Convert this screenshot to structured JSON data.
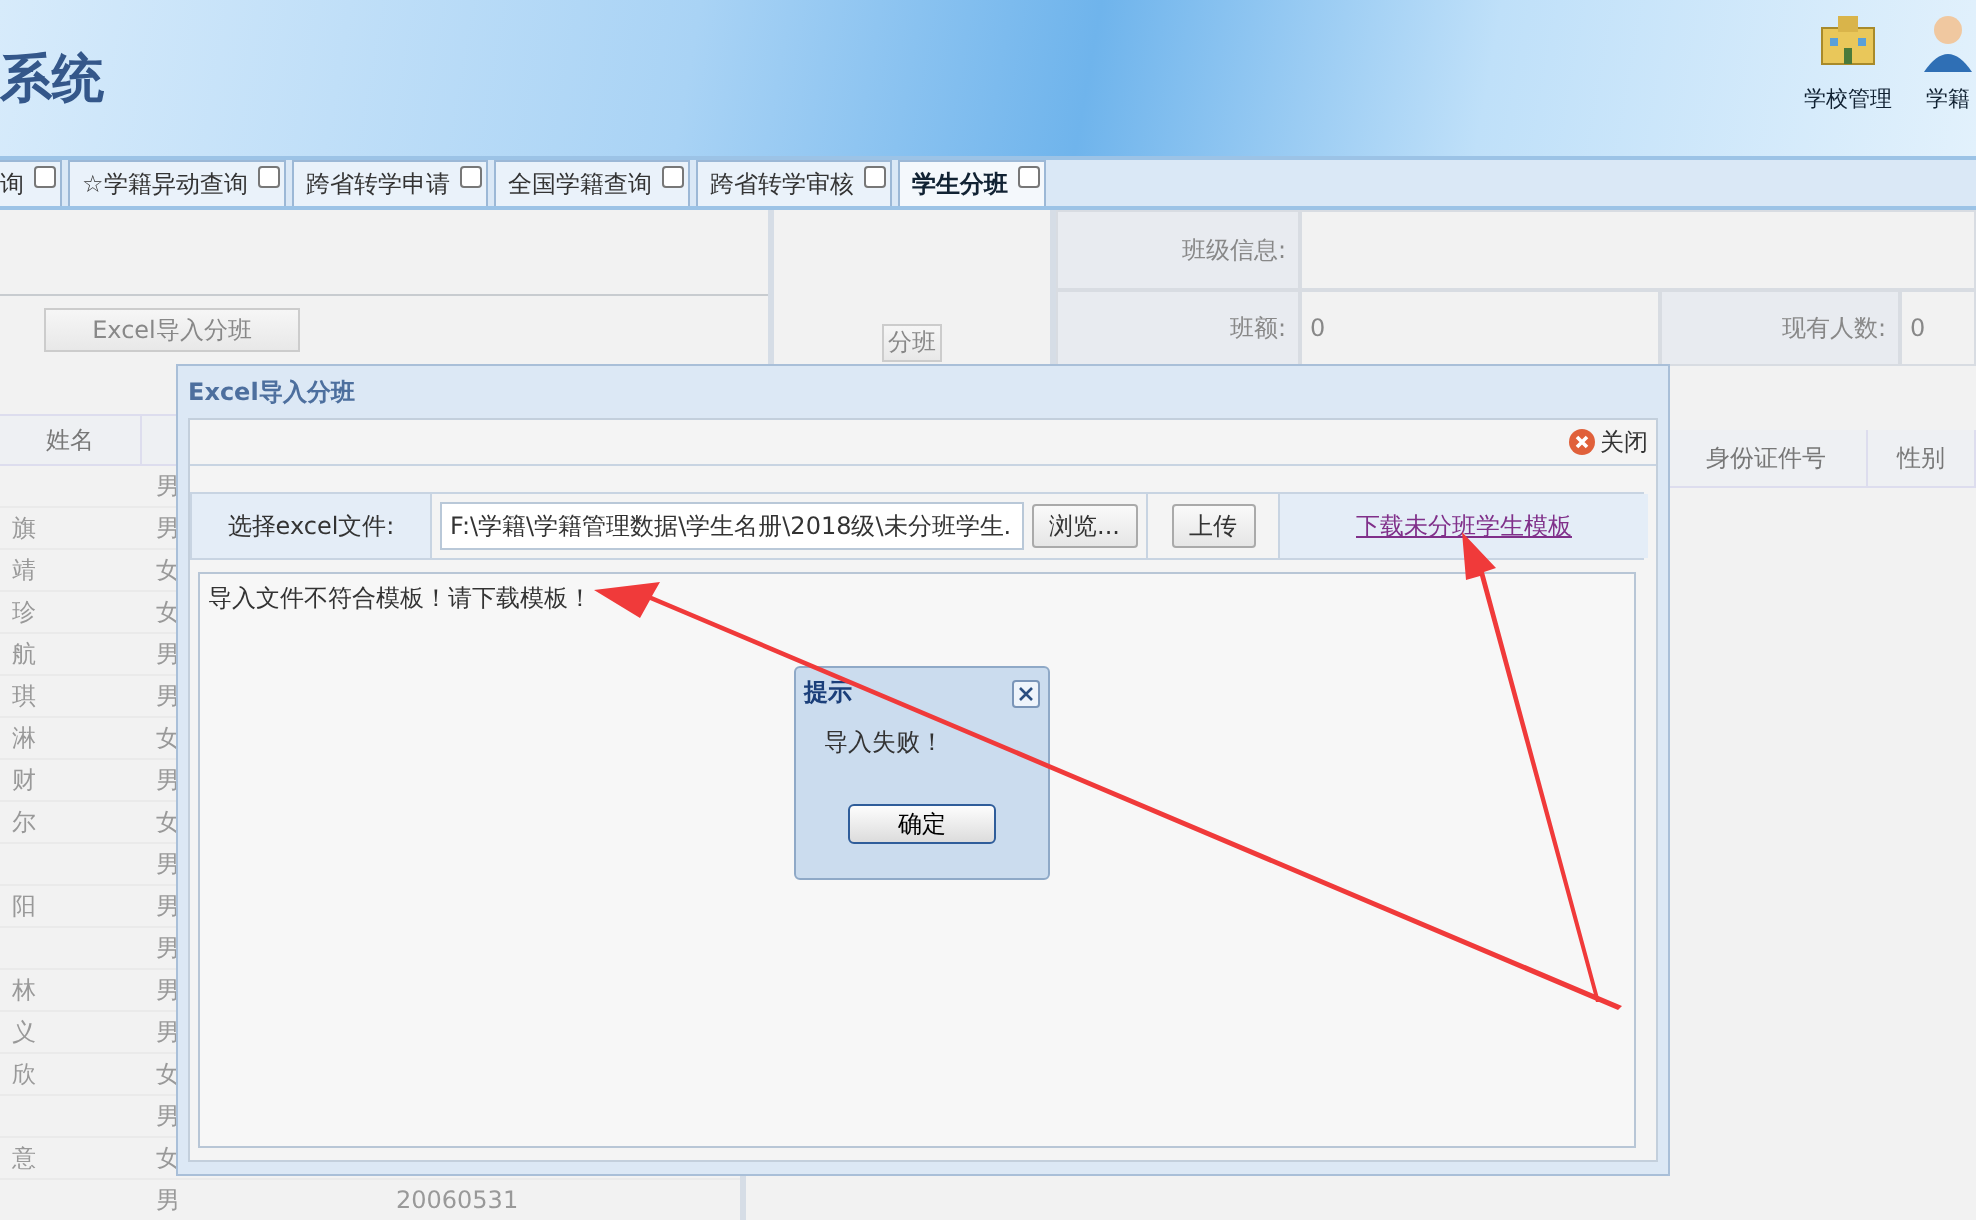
{
  "header": {
    "title": "系统",
    "tools": [
      {
        "label": "学校管理",
        "kind": "school"
      },
      {
        "label": "学籍",
        "kind": "person"
      }
    ]
  },
  "tabs": [
    {
      "label": "询",
      "selected": false
    },
    {
      "label": "☆学籍异动查询",
      "selected": false
    },
    {
      "label": "跨省转学申请",
      "selected": false
    },
    {
      "label": "全国学籍查询",
      "selected": false
    },
    {
      "label": "跨省转学审核",
      "selected": false
    },
    {
      "label": "学生分班",
      "selected": true
    }
  ],
  "left_panel": {
    "import_button": "Excel导入分班",
    "columns": [
      "姓名"
    ],
    "rows": [
      {
        "name": "",
        "gender": "男"
      },
      {
        "name": "旗",
        "gender": "男"
      },
      {
        "name": "靖",
        "gender": "女"
      },
      {
        "name": "珍",
        "gender": "女"
      },
      {
        "name": "航",
        "gender": "男"
      },
      {
        "name": "琪",
        "gender": "男"
      },
      {
        "name": "淋",
        "gender": "女"
      },
      {
        "name": "财",
        "gender": "男"
      },
      {
        "name": "尔",
        "gender": "女"
      },
      {
        "name": "",
        "gender": "男"
      },
      {
        "name": "阳",
        "gender": "男"
      },
      {
        "name": "",
        "gender": "男"
      },
      {
        "name": "林",
        "gender": "男"
      },
      {
        "name": "义",
        "gender": "男"
      },
      {
        "name": "欣",
        "gender": "女"
      },
      {
        "name": "",
        "gender": "男"
      },
      {
        "name": "意",
        "gender": "女"
      },
      {
        "name": "",
        "gender": "男",
        "id": "20060531"
      }
    ]
  },
  "middle_panel": {
    "assign_button": "分班"
  },
  "class_info": {
    "label": "班级信息:",
    "capacity_label": "班额:",
    "capacity": "0",
    "count_label": "现有人数:",
    "count": "0",
    "columns": [
      "身份证件号",
      "性别"
    ]
  },
  "import_dialog": {
    "title": "Excel导入分班",
    "close": "关闭",
    "file_label": "选择excel文件:",
    "file_value": "F:\\学籍\\学籍管理数据\\学生名册\\2018级\\未分班学生.",
    "browse": "浏览...",
    "upload": "上传",
    "template_link": "下载未分班学生模板",
    "message": "导入文件不符合模板！请下载模板！"
  },
  "alert": {
    "title": "提示",
    "message": "导入失败！",
    "ok": "确定"
  }
}
